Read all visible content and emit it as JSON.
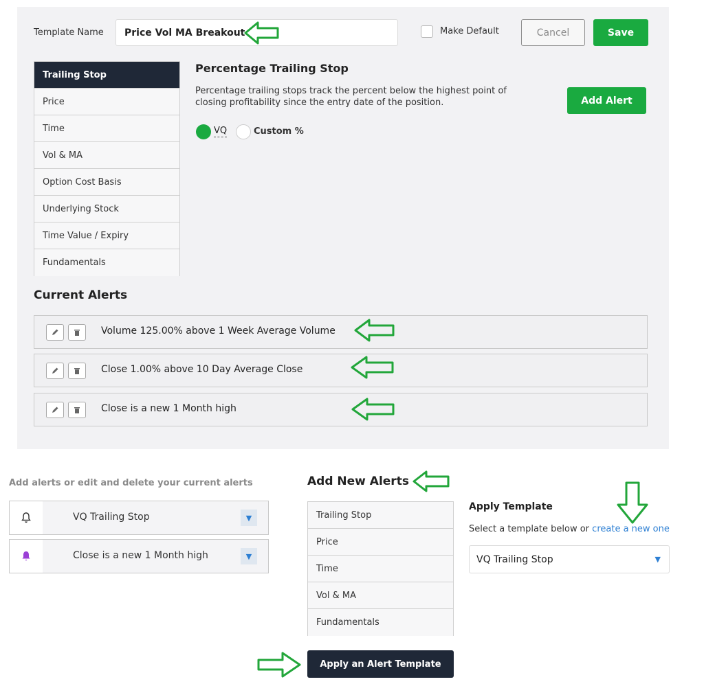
{
  "editor": {
    "template_name_label": "Template Name",
    "template_name_value": "Price Vol MA Breakout",
    "make_default_label": "Make Default",
    "cancel_label": "Cancel",
    "save_label": "Save",
    "tabs": [
      "Trailing Stop",
      "Price",
      "Time",
      "Vol & MA",
      "Option Cost Basis",
      "Underlying Stock",
      "Time Value / Expiry",
      "Fundamentals"
    ],
    "section_title": "Percentage Trailing Stop",
    "description_line1": "Percentage trailing stops track the percent below the highest point of",
    "description_line2": "closing profitability since the entry date of the position.",
    "add_alert_label": "Add Alert",
    "radio_vq": "VQ",
    "radio_custom": "Custom %",
    "current_alerts_title": "Current Alerts",
    "alerts": [
      "Volume 125.00% above 1 Week Average Volume",
      "Close 1.00% above 10 Day Average Close",
      "Close is a new 1 Month high"
    ]
  },
  "lower": {
    "hint": "Add alerts or edit and delete your current alerts",
    "selected_alerts": [
      {
        "label": "VQ Trailing Stop",
        "icon": "bell-outline-icon"
      },
      {
        "label": "Close is a new 1 Month high",
        "icon": "bell-filled-icon",
        "icon_color": "#9b3fd6"
      }
    ],
    "add_new_title": "Add New Alerts",
    "add_new_tabs": [
      "Trailing Stop",
      "Price",
      "Time",
      "Vol & MA",
      "Fundamentals"
    ],
    "apply_button": "Apply an Alert Template",
    "apply_template_title": "Apply Template",
    "apply_template_text": "Select a template below or",
    "apply_template_link": "create a new one",
    "template_select_value": "VQ Trailing Stop"
  },
  "colors": {
    "accent_green": "#1aaa40",
    "dark_navy": "#1f2837",
    "arrow_green": "#22a63a",
    "link_blue": "#2d7fd3"
  }
}
